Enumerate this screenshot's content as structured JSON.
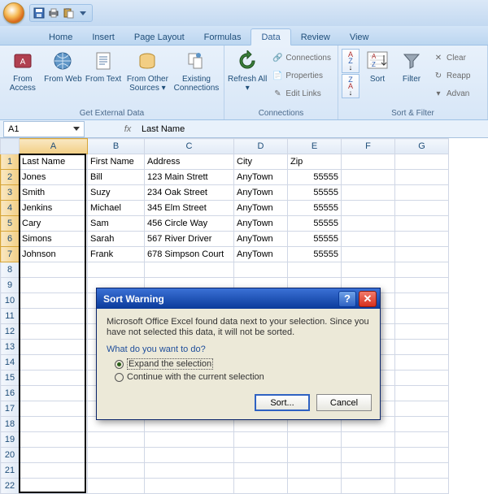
{
  "tabs": [
    "Home",
    "Insert",
    "Page Layout",
    "Formulas",
    "Data",
    "Review",
    "View"
  ],
  "active_tab": "Data",
  "ribbon": {
    "groups": {
      "ged": {
        "label": "Get External Data",
        "btns": [
          "From Access",
          "From Web",
          "From Text",
          "From Other Sources ▾",
          "Existing Connections"
        ]
      },
      "conn": {
        "label": "Connections",
        "big": "Refresh All ▾",
        "small": [
          "Connections",
          "Properties",
          "Edit Links"
        ]
      },
      "sortf": {
        "label": "Sort & Filter",
        "sort": "Sort",
        "filter": "Filter",
        "small": [
          "Clear",
          "Reapp",
          "Advan"
        ]
      }
    }
  },
  "namebox": "A1",
  "formula": "Last Name",
  "columns": [
    "A",
    "B",
    "C",
    "D",
    "E",
    "F",
    "G"
  ],
  "headers": [
    "Last Name",
    "First Name",
    "Address",
    "City",
    "Zip"
  ],
  "rows": [
    [
      "Jones",
      "Bill",
      "123 Main Strett",
      "AnyTown",
      "55555"
    ],
    [
      "Smith",
      "Suzy",
      "234 Oak Street",
      "AnyTown",
      "55555"
    ],
    [
      "Jenkins",
      "Michael",
      "345 Elm Street",
      "AnyTown",
      "55555"
    ],
    [
      "Cary",
      "Sam",
      "456 Circle Way",
      "AnyTown",
      "55555"
    ],
    [
      "Simons",
      "Sarah",
      "567 River Driver",
      "AnyTown",
      "55555"
    ],
    [
      "Johnson",
      "Frank",
      "678 Simpson Court",
      "AnyTown",
      "55555"
    ]
  ],
  "dialog": {
    "title": "Sort Warning",
    "message": "Microsoft Office Excel found data next to your selection.  Since you have not selected this data, it will not be sorted.",
    "question": "What do you want to do?",
    "opts": [
      "Expand the selection",
      "Continue with the current selection"
    ],
    "sort_btn": "Sort...",
    "cancel_btn": "Cancel"
  }
}
